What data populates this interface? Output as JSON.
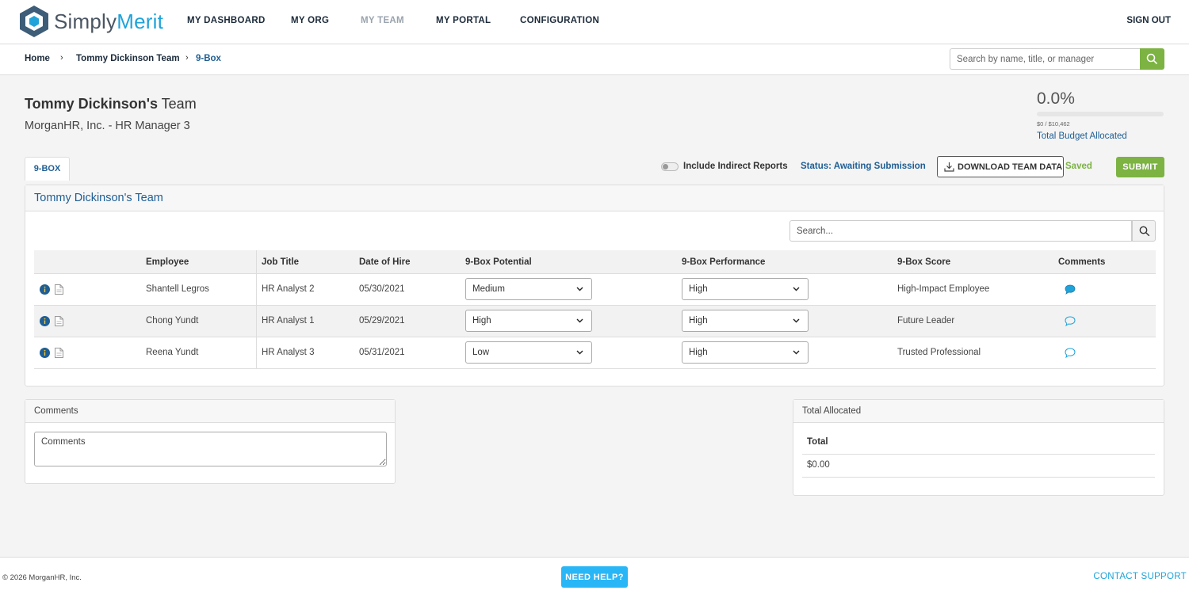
{
  "app": {
    "logo_simply": "Simply",
    "logo_merit": "Merit",
    "logo_icon": "hexagon-cube-icon"
  },
  "nav": {
    "items": [
      "MY DASHBOARD",
      "MY ORG",
      "MY TEAM",
      "MY PORTAL",
      "CONFIGURATION"
    ],
    "active": "MY TEAM",
    "sign_out": "SIGN OUT"
  },
  "breadcrumb": {
    "items": [
      "Home",
      "Tommy Dickinson Team",
      "9-Box"
    ],
    "separator_icon": "chevron-right-icon"
  },
  "top_search": {
    "placeholder": "Search by name, title, or manager",
    "icon": "search-icon"
  },
  "team": {
    "owner": "Tommy Dickinson's",
    "suffix": " Team",
    "subtitle": "MorganHR, Inc. - HR Manager 3"
  },
  "budget": {
    "percent_label": "0.0%",
    "percent_value": 0,
    "amount_label": "$0 / $10,462",
    "link": "Total Budget Allocated"
  },
  "tabs": [
    {
      "label": "9-BOX",
      "active": true
    }
  ],
  "actions": {
    "include_indirect": "Include Indirect Reports",
    "include_indirect_on": false,
    "status": "Status: Awaiting Submission",
    "download": "DOWNLOAD TEAM DATA",
    "download_icon": "download-icon",
    "saved": "Saved",
    "submit": "SUBMIT"
  },
  "panel": {
    "title": "Tommy Dickinson's Team",
    "search_placeholder": "Search..."
  },
  "table": {
    "headers": {
      "employee": "Employee",
      "job_title": "Job Title",
      "hire_date": "Date of Hire",
      "potential": "9-Box Potential",
      "performance": "9-Box Performance",
      "score": "9-Box Score",
      "comments": "Comments"
    },
    "rows": [
      {
        "employee": "Shantell Legros",
        "job_title": "HR Analyst 2",
        "hire_date": "05/30/2021",
        "potential": "Medium",
        "performance": "High",
        "score": "High-Impact Employee",
        "has_comment": true
      },
      {
        "employee": "Chong Yundt",
        "job_title": "HR Analyst 1",
        "hire_date": "05/29/2021",
        "potential": "High",
        "performance": "High",
        "score": "Future Leader",
        "has_comment": false
      },
      {
        "employee": "Reena Yundt",
        "job_title": "HR Analyst 3",
        "hire_date": "05/31/2021",
        "potential": "Low",
        "performance": "High",
        "score": "Trusted Professional",
        "has_comment": false
      }
    ]
  },
  "comments_panel": {
    "title": "Comments",
    "placeholder": "Comments"
  },
  "total_panel": {
    "title": "Total Allocated",
    "label": "Total",
    "value": "$0.00"
  },
  "footer": {
    "copyright": "© 2026 MorganHR, Inc.",
    "help": "NEED HELP?",
    "support": "CONTACT SUPPORT"
  },
  "colors": {
    "accent_green": "#7cb342",
    "link_blue": "#1e5e94",
    "brand_cyan": "#1fa3d9",
    "help_blue": "#29b6f6"
  }
}
